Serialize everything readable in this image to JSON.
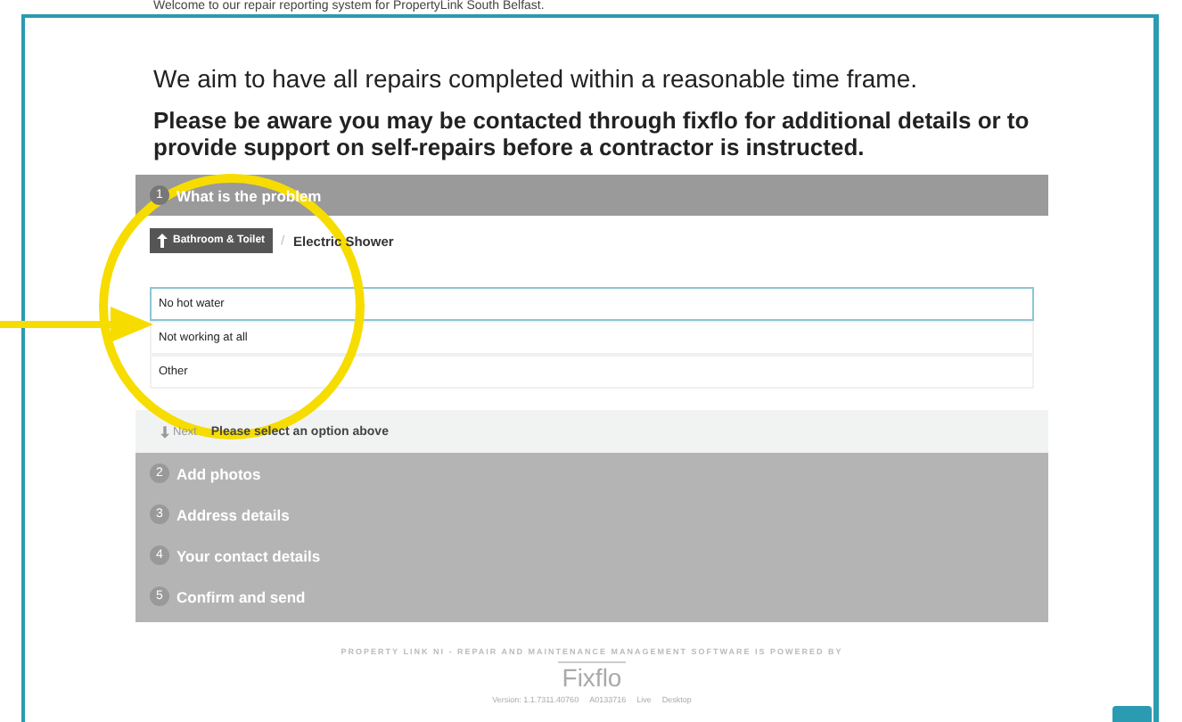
{
  "intro": "Welcome to our repair reporting system for PropertyLink South Belfast.",
  "notice": "We aim to have all repairs completed within a reasonable time frame.",
  "warning": "Please be aware you may be contacted through fixflo for additional details or to provide support on self-repairs before a contractor is instructed.",
  "breadcrumb": {
    "back": "Bathroom & Toilet",
    "separator": "/",
    "current": "Electric Shower"
  },
  "options": [
    {
      "label": "No hot water",
      "selected": true
    },
    {
      "label": "Not working at all",
      "selected": false
    },
    {
      "label": "Other",
      "selected": false
    }
  ],
  "next": {
    "label": "Next",
    "hint": "Please select an option above",
    "disabled": true
  },
  "steps": [
    {
      "number": "1",
      "title": "What is the problem",
      "expanded": true
    },
    {
      "number": "2",
      "title": "Add photos",
      "expanded": false
    },
    {
      "number": "3",
      "title": "Address details",
      "expanded": false
    },
    {
      "number": "4",
      "title": "Your contact details",
      "expanded": false
    },
    {
      "number": "5",
      "title": "Confirm and send",
      "expanded": false
    }
  ],
  "footer": {
    "powered": "PROPERTY LINK NI - REPAIR AND MAINTENANCE MANAGEMENT SOFTWARE IS POWERED BY",
    "logo": "Fixflo",
    "version": [
      "Version: 1.1.7311.40760",
      "A0133716",
      "Live",
      "Desktop"
    ]
  }
}
